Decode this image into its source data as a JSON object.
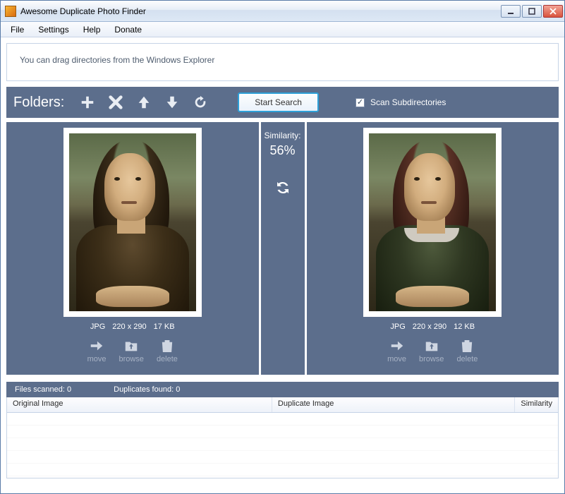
{
  "window": {
    "title": "Awesome Duplicate Photo Finder"
  },
  "menu": {
    "file": "File",
    "settings": "Settings",
    "help": "Help",
    "donate": "Donate"
  },
  "drop_hint": "You can drag directories from the Windows Explorer",
  "toolbar": {
    "folders_label": "Folders:",
    "start_search": "Start Search",
    "scan_sub": "Scan Subdirectories",
    "scan_sub_checked": true
  },
  "similarity": {
    "label": "Similarity:",
    "value": "56%"
  },
  "left_image": {
    "format": "JPG",
    "dimensions": "220 x 290",
    "size": "17 KB"
  },
  "right_image": {
    "format": "JPG",
    "dimensions": "220 x 290",
    "size": "12 KB"
  },
  "actions": {
    "move": "move",
    "browse": "browse",
    "delete": "delete"
  },
  "status": {
    "files_scanned_label": "Files scanned:",
    "files_scanned": "0",
    "duplicates_found_label": "Duplicates found:",
    "duplicates_found": "0"
  },
  "table": {
    "col_original": "Original Image",
    "col_duplicate": "Duplicate Image",
    "col_similarity": "Similarity"
  }
}
